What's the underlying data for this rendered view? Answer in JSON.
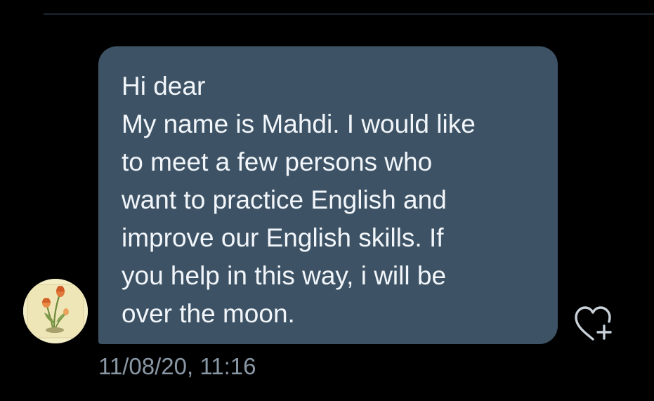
{
  "message": {
    "text": "Hi dear\nMy name is Mahdi. I would like\nto meet a few persons who\nwant to practice English and\nimprove our English skills. If\nyou help in this way, i will be\nover the moon.",
    "timestamp": "11/08/20, 11:16"
  },
  "sender": {
    "avatar_icon": "tulip-illustration"
  },
  "actions": {
    "reaction_icon": "heart-plus-icon"
  },
  "colors": {
    "background": "#000000",
    "bubble": "#3d5365",
    "bubble_text": "#f2f6fa",
    "timestamp": "#8a98a6",
    "icon": "#c8d0d8"
  }
}
